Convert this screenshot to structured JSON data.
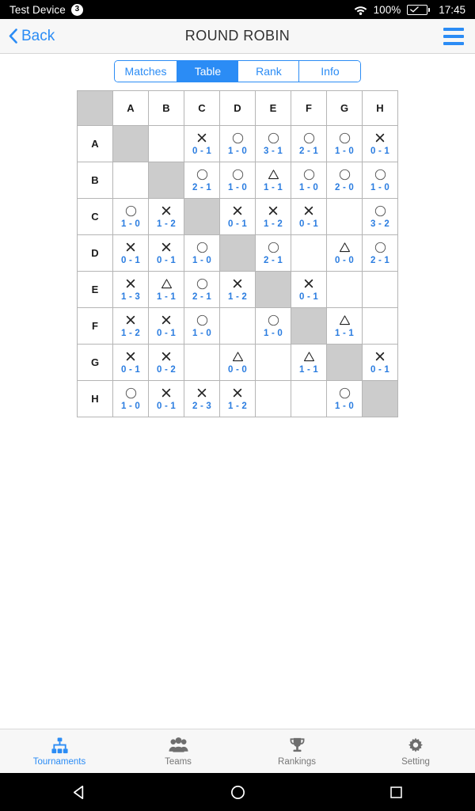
{
  "statusbar": {
    "device": "Test Device",
    "badge": "3",
    "battery_percent": "100%",
    "time": "17:45",
    "wifi_icon": "wifi-icon",
    "battery_icon": "battery-charging-icon"
  },
  "navbar": {
    "back_label": "Back",
    "back_icon": "chevron-left-icon",
    "title": "ROUND ROBIN",
    "menu_icon": "hamburger-menu-icon"
  },
  "segments": [
    {
      "label": "Matches",
      "active": false
    },
    {
      "label": "Table",
      "active": true
    },
    {
      "label": "Rank",
      "active": false
    },
    {
      "label": "Info",
      "active": false
    }
  ],
  "table": {
    "corner_label": "",
    "columns": [
      "A",
      "B",
      "C",
      "D",
      "E",
      "F",
      "G",
      "H"
    ],
    "rows": [
      {
        "label": "A",
        "cells": [
          {
            "type": "diagonal"
          },
          {
            "type": "empty"
          },
          {
            "type": "result",
            "mark": "loss",
            "score": "0 - 1"
          },
          {
            "type": "result",
            "mark": "win",
            "score": "1 - 0"
          },
          {
            "type": "result",
            "mark": "win",
            "score": "3 - 1"
          },
          {
            "type": "result",
            "mark": "win",
            "score": "2 - 1"
          },
          {
            "type": "result",
            "mark": "win",
            "score": "1 - 0"
          },
          {
            "type": "result",
            "mark": "loss",
            "score": "0 - 1"
          }
        ]
      },
      {
        "label": "B",
        "cells": [
          {
            "type": "empty"
          },
          {
            "type": "diagonal"
          },
          {
            "type": "result",
            "mark": "win",
            "score": "2 - 1"
          },
          {
            "type": "result",
            "mark": "win",
            "score": "1 - 0"
          },
          {
            "type": "result",
            "mark": "draw",
            "score": "1 - 1"
          },
          {
            "type": "result",
            "mark": "win",
            "score": "1 - 0"
          },
          {
            "type": "result",
            "mark": "win",
            "score": "2 - 0"
          },
          {
            "type": "result",
            "mark": "win",
            "score": "1 - 0"
          }
        ]
      },
      {
        "label": "C",
        "cells": [
          {
            "type": "result",
            "mark": "win",
            "score": "1 - 0"
          },
          {
            "type": "result",
            "mark": "loss",
            "score": "1 - 2"
          },
          {
            "type": "diagonal"
          },
          {
            "type": "result",
            "mark": "loss",
            "score": "0 - 1"
          },
          {
            "type": "result",
            "mark": "loss",
            "score": "1 - 2"
          },
          {
            "type": "result",
            "mark": "loss",
            "score": "0 - 1"
          },
          {
            "type": "empty"
          },
          {
            "type": "result",
            "mark": "win",
            "score": "3 - 2"
          }
        ]
      },
      {
        "label": "D",
        "cells": [
          {
            "type": "result",
            "mark": "loss",
            "score": "0 - 1"
          },
          {
            "type": "result",
            "mark": "loss",
            "score": "0 - 1"
          },
          {
            "type": "result",
            "mark": "win",
            "score": "1 - 0"
          },
          {
            "type": "diagonal"
          },
          {
            "type": "result",
            "mark": "win",
            "score": "2 - 1"
          },
          {
            "type": "empty"
          },
          {
            "type": "result",
            "mark": "draw",
            "score": "0 - 0"
          },
          {
            "type": "result",
            "mark": "win",
            "score": "2 - 1"
          }
        ]
      },
      {
        "label": "E",
        "cells": [
          {
            "type": "result",
            "mark": "loss",
            "score": "1 - 3"
          },
          {
            "type": "result",
            "mark": "draw",
            "score": "1 - 1"
          },
          {
            "type": "result",
            "mark": "win",
            "score": "2 - 1"
          },
          {
            "type": "result",
            "mark": "loss",
            "score": "1 - 2"
          },
          {
            "type": "diagonal"
          },
          {
            "type": "result",
            "mark": "loss",
            "score": "0 - 1"
          },
          {
            "type": "empty"
          },
          {
            "type": "empty"
          }
        ]
      },
      {
        "label": "F",
        "cells": [
          {
            "type": "result",
            "mark": "loss",
            "score": "1 - 2"
          },
          {
            "type": "result",
            "mark": "loss",
            "score": "0 - 1"
          },
          {
            "type": "result",
            "mark": "win",
            "score": "1 - 0"
          },
          {
            "type": "empty"
          },
          {
            "type": "result",
            "mark": "win",
            "score": "1 - 0"
          },
          {
            "type": "diagonal"
          },
          {
            "type": "result",
            "mark": "draw",
            "score": "1 - 1"
          },
          {
            "type": "empty"
          }
        ]
      },
      {
        "label": "G",
        "cells": [
          {
            "type": "result",
            "mark": "loss",
            "score": "0 - 1"
          },
          {
            "type": "result",
            "mark": "loss",
            "score": "0 - 2"
          },
          {
            "type": "empty"
          },
          {
            "type": "result",
            "mark": "draw",
            "score": "0 - 0"
          },
          {
            "type": "empty"
          },
          {
            "type": "result",
            "mark": "draw",
            "score": "1 - 1"
          },
          {
            "type": "diagonal"
          },
          {
            "type": "result",
            "mark": "loss",
            "score": "0 - 1"
          }
        ]
      },
      {
        "label": "H",
        "cells": [
          {
            "type": "result",
            "mark": "win",
            "score": "1 - 0"
          },
          {
            "type": "result",
            "mark": "loss",
            "score": "0 - 1"
          },
          {
            "type": "result",
            "mark": "loss",
            "score": "2 - 3"
          },
          {
            "type": "result",
            "mark": "loss",
            "score": "1 - 2"
          },
          {
            "type": "empty"
          },
          {
            "type": "empty"
          },
          {
            "type": "result",
            "mark": "win",
            "score": "1 - 0"
          },
          {
            "type": "diagonal"
          }
        ]
      }
    ]
  },
  "tabbar": [
    {
      "label": "Tournaments",
      "icon": "tournament-bracket-icon",
      "active": true
    },
    {
      "label": "Teams",
      "icon": "people-group-icon",
      "active": false
    },
    {
      "label": "Rankings",
      "icon": "trophy-icon",
      "active": false
    },
    {
      "label": "Setting",
      "icon": "gear-icon",
      "active": false
    }
  ],
  "androidnav": [
    {
      "icon": "back-triangle-icon"
    },
    {
      "icon": "home-circle-icon"
    },
    {
      "icon": "recents-square-icon"
    }
  ],
  "colors": {
    "accent": "#2b8cf5",
    "score_blue": "#2b7de0",
    "diagonal_gray": "#cccccc",
    "border_gray": "#b5b5b5"
  }
}
